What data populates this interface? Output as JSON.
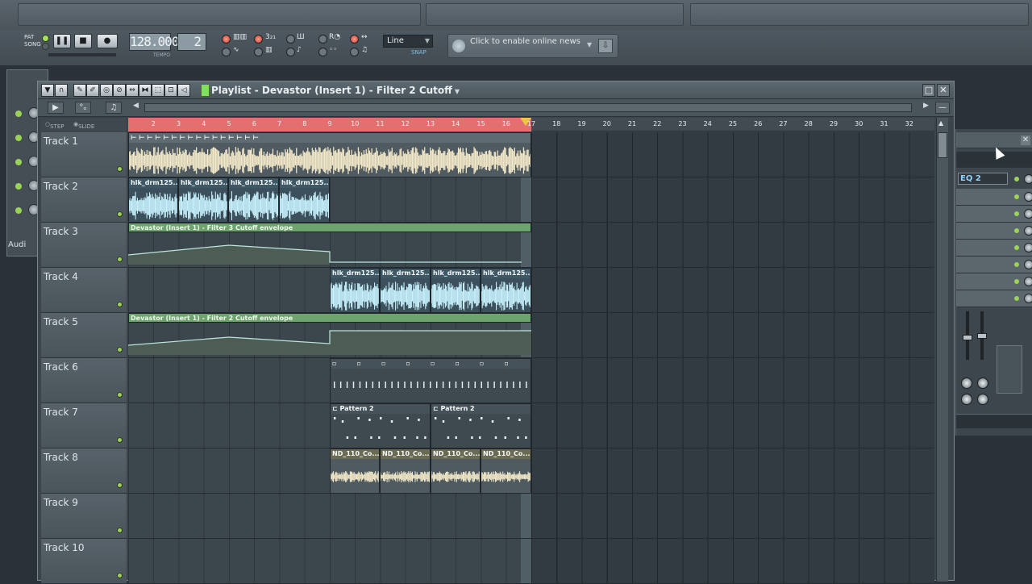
{
  "toolbar": {
    "mode_pat": "PAT",
    "mode_song": "SONG",
    "pause_icon": "pause-icon",
    "stop_icon": "stop-icon",
    "record_icon": "record-icon",
    "tempo_value": "128.000",
    "tempo_label": "TEMPO",
    "pattern_value": "2",
    "snap_value": "Line",
    "snap_label": "SNAP",
    "news_text": "Click to enable online news"
  },
  "background": {
    "audio_label": "Audi",
    "mixer_label": "EQ 2"
  },
  "playlist": {
    "title": "Playlist - Devastor (Insert 1) - Filter 2 Cutoff",
    "ruler_step": "STEP",
    "ruler_slide": "SLIDE",
    "ruler_numbers": [
      "2",
      "3",
      "4",
      "5",
      "6",
      "7",
      "8",
      "9",
      "10",
      "11",
      "12",
      "13",
      "14",
      "15",
      "16",
      "17",
      "18",
      "19",
      "20",
      "21",
      "22",
      "23",
      "24",
      "25",
      "26",
      "27",
      "28",
      "29",
      "30",
      "31",
      "32"
    ],
    "tracks": [
      {
        "name": "Track 1"
      },
      {
        "name": "Track 2"
      },
      {
        "name": "Track 3"
      },
      {
        "name": "Track 4"
      },
      {
        "name": "Track 5"
      },
      {
        "name": "Track 6"
      },
      {
        "name": "Track 7"
      },
      {
        "name": "Track 8"
      },
      {
        "name": "Track 9"
      },
      {
        "name": "Track 10"
      }
    ],
    "clip_labels": {
      "hlk": "hlk_drm125...",
      "filter3": "Devastor (Insert 1) - Filter 3 Cutoff envelope",
      "filter2": "Devastor (Insert 1) - Filter 2 Cutoff envelope",
      "pattern2": "Pattern 2",
      "nd110": "ND_110_Co..."
    }
  },
  "colors": {
    "loop_region": "#e3706e",
    "audio_cream": "#f3e9c9",
    "audio_cyan": "#c9f4ff",
    "automation": "#6fa36e",
    "led_green": "#9ad356"
  }
}
